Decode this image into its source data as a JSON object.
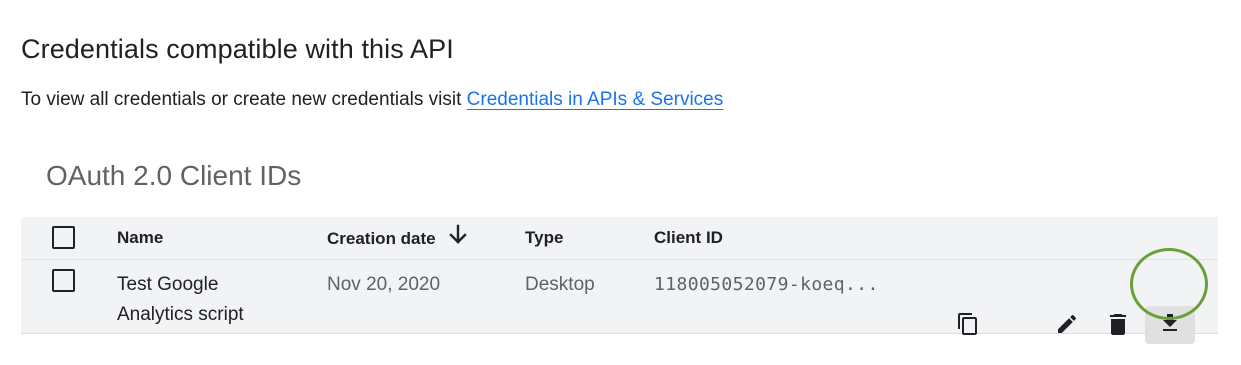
{
  "header": {
    "title": "Credentials compatible with this API",
    "subtitle_text": "To view all credentials or create new credentials visit ",
    "subtitle_link": "Credentials in APIs & Services"
  },
  "section": {
    "title": "OAuth 2.0 Client IDs"
  },
  "table": {
    "columns": {
      "name": "Name",
      "creation_date": "Creation date",
      "type": "Type",
      "client_id": "Client ID"
    },
    "sort": {
      "column": "creation_date",
      "direction": "descending",
      "icon": "arrow-down-icon"
    },
    "rows": [
      {
        "name": "Test Google Analytics script",
        "creation_date": "Nov 20, 2020",
        "type": "Desktop",
        "client_id": "118005052079-koeq...",
        "actions": [
          "copy-icon",
          "edit-icon",
          "delete-icon",
          "download-icon"
        ]
      }
    ]
  },
  "colors": {
    "link": "#1a73e8",
    "table_bg": "#f1f3f4",
    "highlight": "#689f38"
  }
}
